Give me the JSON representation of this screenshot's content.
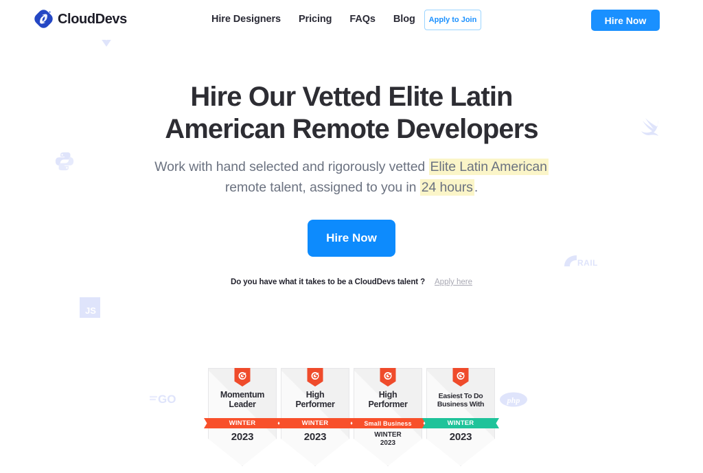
{
  "header": {
    "brand": {
      "name": "CloudDevs",
      "logo_icon": "clouddevs-diamond-logo",
      "color": "#1d1d28"
    },
    "nav_links": [
      {
        "label": "Hire Designers"
      },
      {
        "label": "Pricing"
      },
      {
        "label": "FAQs"
      },
      {
        "label": "Blog"
      }
    ],
    "apply_to_join": {
      "label": "Apply to Join",
      "color": "#1a90ff",
      "border": "#9ad4ff"
    },
    "hire_now": {
      "label": "Hire Now",
      "bg": "#1a90ff",
      "color": "#ffffff"
    }
  },
  "hero": {
    "headline_line1": "Hire Our Vetted Elite Latin",
    "headline_line2": "American Remote Developers",
    "subhead": {
      "part1": "Work with hand selected and rigorously vetted ",
      "highlight1": "Elite Latin American",
      "part2": " remote talent, assigned to you in ",
      "highlight2": "24 hours",
      "part3": ".",
      "highlight_color": "#fbf5c8"
    },
    "cta": {
      "label": "Hire Now",
      "bg": "#0d8bfd"
    },
    "talent_prompt": "Do you have what it takes to be a CloudDevs talent  ?",
    "apply_here": "Apply here"
  },
  "badges": [
    {
      "logo": "g2-logo",
      "title_line1": "Momentum",
      "title_line2": "Leader",
      "ribbon": "WINTER",
      "ribbon_color": "#f8502b",
      "year": "2023",
      "sub_line1": "",
      "sub_line2": ""
    },
    {
      "logo": "g2-logo",
      "title_line1": "High",
      "title_line2": "Performer",
      "ribbon": "WINTER",
      "ribbon_color": "#f8502b",
      "year": "2023",
      "sub_line1": "",
      "sub_line2": ""
    },
    {
      "logo": "g2-logo",
      "title_line1": "High",
      "title_line2": "Performer",
      "ribbon": "Small Business",
      "ribbon_color": "#f8502b",
      "year": "",
      "sub_line1": "WINTER",
      "sub_line2": "2023"
    },
    {
      "logo": "g2-logo",
      "title_line1": "Easiest To Do",
      "title_line2": "Business With",
      "ribbon": "WINTER",
      "ribbon_color": "#1fc39a",
      "year": "2023",
      "sub_line1": "",
      "sub_line2": ""
    }
  ],
  "decor": {
    "color": "#dfe4fb",
    "items": [
      {
        "icon": "python-logo"
      },
      {
        "icon": "javascript-logo",
        "label": "JS"
      },
      {
        "icon": "golang-logo",
        "label": "GO"
      },
      {
        "icon": "php-logo",
        "label": "php"
      },
      {
        "icon": "rails-logo",
        "label": "RAILS"
      },
      {
        "icon": "swift-logo"
      },
      {
        "icon": "vue-logo"
      }
    ]
  }
}
